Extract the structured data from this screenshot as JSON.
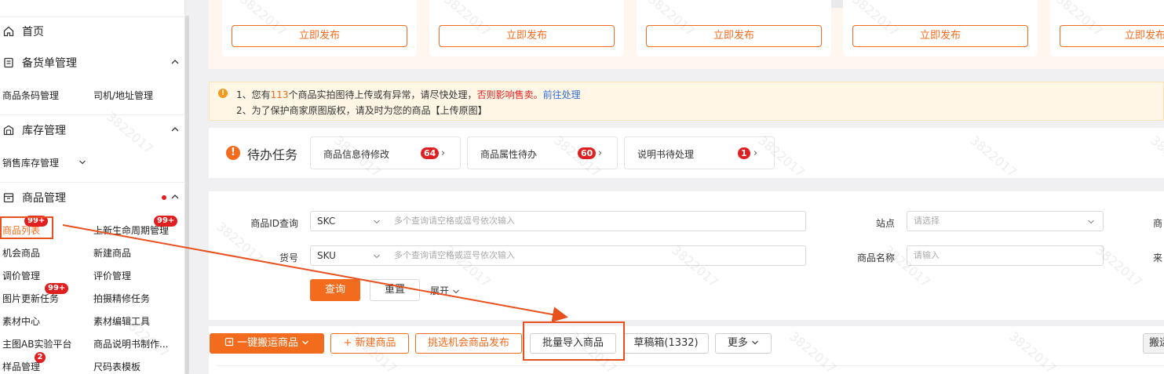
{
  "sidebar": {
    "home": "首页",
    "groups": [
      {
        "label": "备货单管理",
        "items": [
          "商品条码管理",
          "司机/地址管理"
        ]
      },
      {
        "label": "库存管理",
        "items": [
          "销售库存管理"
        ]
      },
      {
        "label": "商品管理"
      }
    ],
    "goods_items": [
      {
        "label": "商品列表",
        "badge": "99+"
      },
      {
        "label": "上新生命周期管理",
        "badge": "99+"
      },
      {
        "label": "机会商品"
      },
      {
        "label": "新建商品"
      },
      {
        "label": "调价管理"
      },
      {
        "label": "评价管理"
      },
      {
        "label": "图片更新任务",
        "badge": "99+"
      },
      {
        "label": "拍摄精修任务"
      },
      {
        "label": "素材中心"
      },
      {
        "label": "素材编辑工具"
      },
      {
        "label": "主图AB实验平台"
      },
      {
        "label": "商品说明书制作..."
      },
      {
        "label": "样品管理",
        "badge": "2"
      },
      {
        "label": "尺码表模板"
      }
    ]
  },
  "top_cards": {
    "publish_label": "立即发布",
    "last_publish_label": "立即发布"
  },
  "notice": {
    "l1_prefix": "1、您有",
    "l1_count": "113",
    "l1_mid": "个商品实拍图待上传或有异常，请尽快处理，",
    "l1_warn": "否则影响售卖。",
    "l1_link": "前往处理",
    "l2": "2、为了保护商家原图版权，请及时为您的商品【上传原图】"
  },
  "todo": {
    "title": "待办任务",
    "cards": [
      {
        "label": "商品信息待修改",
        "count": "64"
      },
      {
        "label": "商品属性待办",
        "count": "60"
      },
      {
        "label": "说明书待处理",
        "count": "1"
      }
    ]
  },
  "filter": {
    "id_label": "商品ID查询",
    "id_type": "SKC",
    "id_placeholder": "多个查询请空格或逗号依次输入",
    "site_label": "站点",
    "site_placeholder": "请选择",
    "right_label_1": "商",
    "sku_label": "货号",
    "sku_type": "SKU",
    "sku_placeholder": "多个查询请空格或逗号依次输入",
    "name_label": "商品名称",
    "name_placeholder": "请输入",
    "right_label_2": "来",
    "query": "查询",
    "reset": "重置",
    "expand": "展开"
  },
  "actions": {
    "move": "一键搬运商品",
    "new": "新建商品",
    "pick": "挑选机会商品发布",
    "batch_import": "批量导入商品",
    "drafts": "草稿箱(1332)",
    "more": "更多",
    "right_clip": "搬运"
  },
  "watermark": "3822017",
  "colors": {
    "accent": "#f36b1c",
    "badge": "#e02020",
    "annotation": "#e8501e",
    "link": "#2f6fd6"
  }
}
